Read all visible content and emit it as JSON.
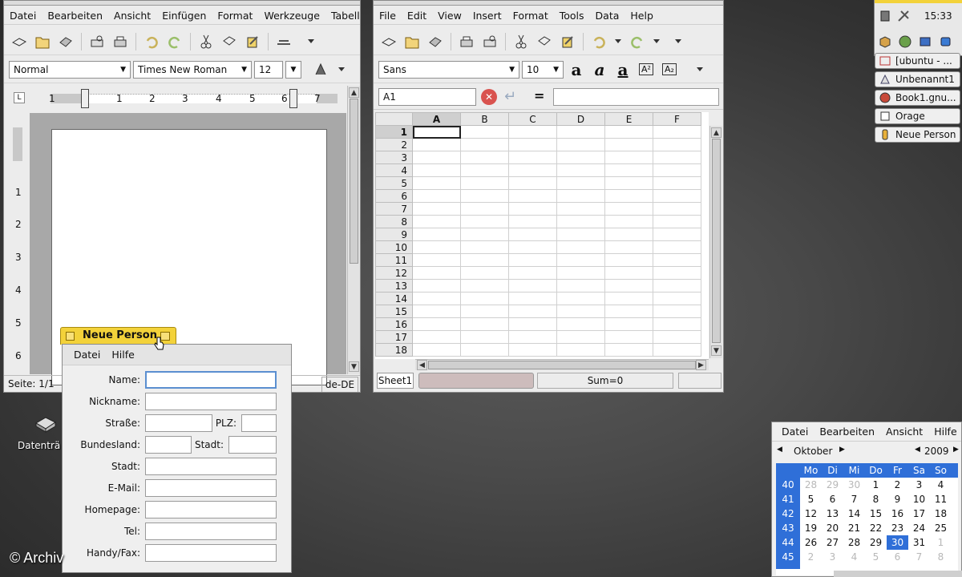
{
  "writer": {
    "title": "Unbenannt1",
    "menu": [
      "Datei",
      "Bearbeiten",
      "Ansicht",
      "Einfügen",
      "Format",
      "Werkzeuge",
      "Tabell"
    ],
    "style_value": "Normal",
    "font_value": "Times New Roman",
    "size_value": "12",
    "ruler_marks": [
      "1",
      "1",
      "2",
      "3",
      "4",
      "5",
      "6",
      "7"
    ],
    "vruler_marks": [
      "1",
      "2",
      "3",
      "4",
      "5",
      "6"
    ],
    "status_page": "Seite: 1/1",
    "status_lang": "de-DE"
  },
  "calc": {
    "menu": [
      "File",
      "Edit",
      "View",
      "Insert",
      "Format",
      "Tools",
      "Data",
      "Help"
    ],
    "font_value": "Sans",
    "size_value": "10",
    "cell_ref": "A1",
    "equals": "=",
    "columns": [
      "A",
      "B",
      "C",
      "D",
      "E",
      "F"
    ],
    "rows": [
      "1",
      "2",
      "3",
      "4",
      "5",
      "6",
      "7",
      "8",
      "9",
      "10",
      "11",
      "12",
      "13",
      "14",
      "15",
      "16",
      "17",
      "18"
    ],
    "sheet_tab": "Sheet1",
    "status_sum": "Sum=0"
  },
  "person": {
    "title": "Neue Person",
    "menu": [
      "Datei",
      "Hilfe"
    ],
    "labels": {
      "name": "Name:",
      "nickname": "Nickname:",
      "strasse": "Straße:",
      "plz": "PLZ:",
      "bundesland": "Bundesland:",
      "stadt_inline": "Stadt:",
      "stadt": "Stadt:",
      "email": "E-Mail:",
      "homepage": "Homepage:",
      "tel": "Tel:",
      "fax": "Handy/Fax:"
    }
  },
  "desktop": {
    "icon_label": "Datenträ",
    "watermark": "© Archiv"
  },
  "panel": {
    "clock": "15:33",
    "tasks": [
      "[ubuntu - ...",
      "Unbenannt1",
      "Book1.gnu...",
      "Orage",
      "Neue Person"
    ]
  },
  "calendar": {
    "menu": [
      "Datei",
      "Bearbeiten",
      "Ansicht",
      "Hilfe"
    ],
    "month": "Oktober",
    "year": "2009",
    "weekdays": [
      "Mo",
      "Di",
      "Mi",
      "Do",
      "Fr",
      "Sa",
      "So"
    ],
    "weeks": [
      {
        "wk": "40",
        "days": [
          "28",
          "29",
          "30",
          "1",
          "2",
          "3",
          "4"
        ]
      },
      {
        "wk": "41",
        "days": [
          "5",
          "6",
          "7",
          "8",
          "9",
          "10",
          "11"
        ]
      },
      {
        "wk": "42",
        "days": [
          "12",
          "13",
          "14",
          "15",
          "16",
          "17",
          "18"
        ]
      },
      {
        "wk": "43",
        "days": [
          "19",
          "20",
          "21",
          "22",
          "23",
          "24",
          "25"
        ]
      },
      {
        "wk": "44",
        "days": [
          "26",
          "27",
          "28",
          "29",
          "30",
          "31",
          "1"
        ]
      },
      {
        "wk": "45",
        "days": [
          "2",
          "3",
          "4",
          "5",
          "6",
          "7",
          "8"
        ]
      }
    ],
    "selected_day": "30"
  },
  "colors": {
    "accent_blue": "#2f6fd8",
    "title_yellow": "#f3d23a",
    "error_red": "#d9534f"
  }
}
